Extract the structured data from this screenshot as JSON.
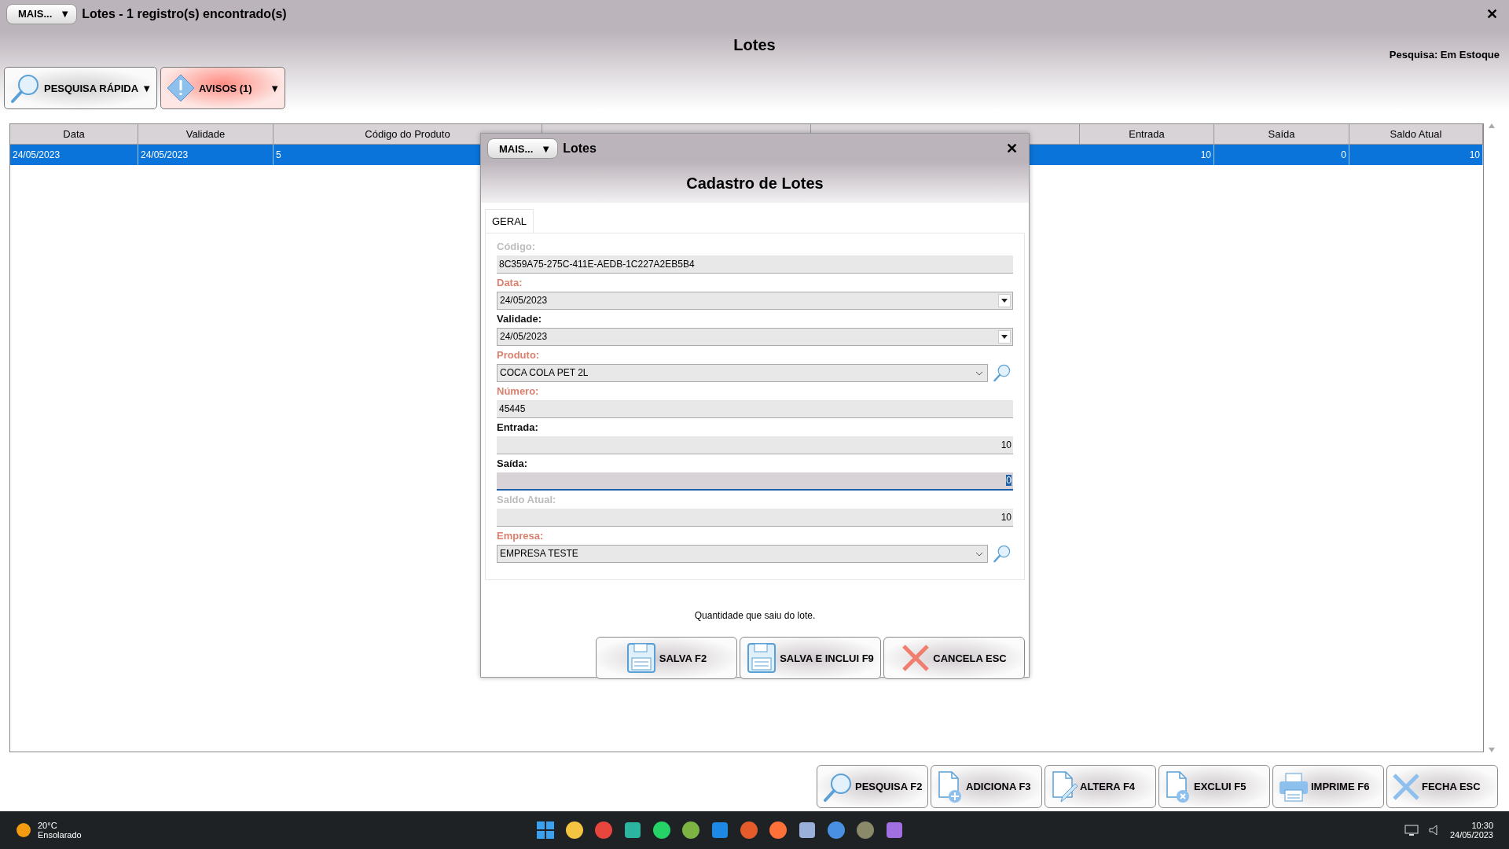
{
  "window": {
    "menu_button": "MAIS...",
    "menu_caret": "▼",
    "title": "Lotes - 1 registro(s) encontrado(s)",
    "close": "✕"
  },
  "heading": "Lotes",
  "search_mode": "Pesquisa: Em Estoque",
  "toolbar": [
    {
      "kind": "search",
      "label": "PESQUISA RÁPIDA",
      "caret": "▼"
    },
    {
      "kind": "warning",
      "label": "AVISOS (1)",
      "caret": "▼"
    }
  ],
  "table": {
    "columns": [
      {
        "label": "Data"
      },
      {
        "label": "Validade"
      },
      {
        "label": "Código do Produto"
      },
      {},
      {},
      {
        "label": "Entrada"
      },
      {
        "label": "Saída"
      },
      {
        "label": "Saldo Atual"
      }
    ],
    "rows": [
      {
        "selected": true,
        "cells": [
          "24/05/2023",
          "24/05/2023",
          "5",
          null,
          null,
          "10",
          "0",
          "10"
        ]
      }
    ]
  },
  "dialog": {
    "menu_button": "MAIS...",
    "menu_caret": "▼",
    "title": "Lotes",
    "close": "✕",
    "heading": "Cadastro de Lotes",
    "tabs": [
      {
        "label": "GERAL",
        "selected": true
      }
    ],
    "fields": [
      {
        "label": "Código:",
        "value": "8C359A75-275C-411E-AEDB-1C227A2EB5B4",
        "kind": "text",
        "required": false,
        "disabled": true,
        "focused": false
      },
      {
        "label": "Data:",
        "value": "24/05/2023",
        "kind": "date",
        "required": true,
        "disabled": false,
        "focused": false
      },
      {
        "label": "Validade:",
        "value": "24/05/2023",
        "kind": "date",
        "required": false,
        "disabled": false,
        "focused": false
      },
      {
        "label": "Produto:",
        "value": "COCA COLA PET 2L",
        "kind": "lookup",
        "required": true,
        "disabled": false,
        "focused": false
      },
      {
        "label": "Número:",
        "value": "45445",
        "kind": "text",
        "required": true,
        "disabled": false,
        "focused": false
      },
      {
        "label": "Entrada:",
        "value": "10",
        "kind": "number",
        "required": false,
        "disabled": false,
        "focused": false
      },
      {
        "label": "Saída:",
        "value": "0",
        "kind": "number",
        "required": false,
        "disabled": false,
        "focused": true
      },
      {
        "label": "Saldo Atual:",
        "value": "10",
        "kind": "number",
        "required": false,
        "disabled": true,
        "focused": false
      },
      {
        "label": "Empresa:",
        "value": "EMPRESA TESTE",
        "kind": "lookup",
        "required": true,
        "disabled": false,
        "focused": false
      }
    ],
    "hint": "Quantidade que saiu do lote.",
    "buttons": [
      {
        "kind": "save",
        "label": "SALVA F2"
      },
      {
        "kind": "save",
        "label": "SALVA E INCLUI F9"
      },
      {
        "kind": "cancel",
        "label": "CANCELA ESC"
      }
    ]
  },
  "actions": [
    {
      "kind": "search",
      "label": "PESQUISA F2"
    },
    {
      "kind": "add",
      "label": "ADICIONA F3"
    },
    {
      "kind": "edit",
      "label": "ALTERA F4"
    },
    {
      "kind": "delete",
      "label": "EXCLUI F5"
    },
    {
      "kind": "print",
      "label": "IMPRIME F6"
    },
    {
      "kind": "close",
      "label": "FECHA ESC"
    }
  ],
  "taskbar": {
    "temperature": "20°C",
    "weather": "Ensolarado",
    "time": "10:30",
    "date": "24/05/2023"
  }
}
